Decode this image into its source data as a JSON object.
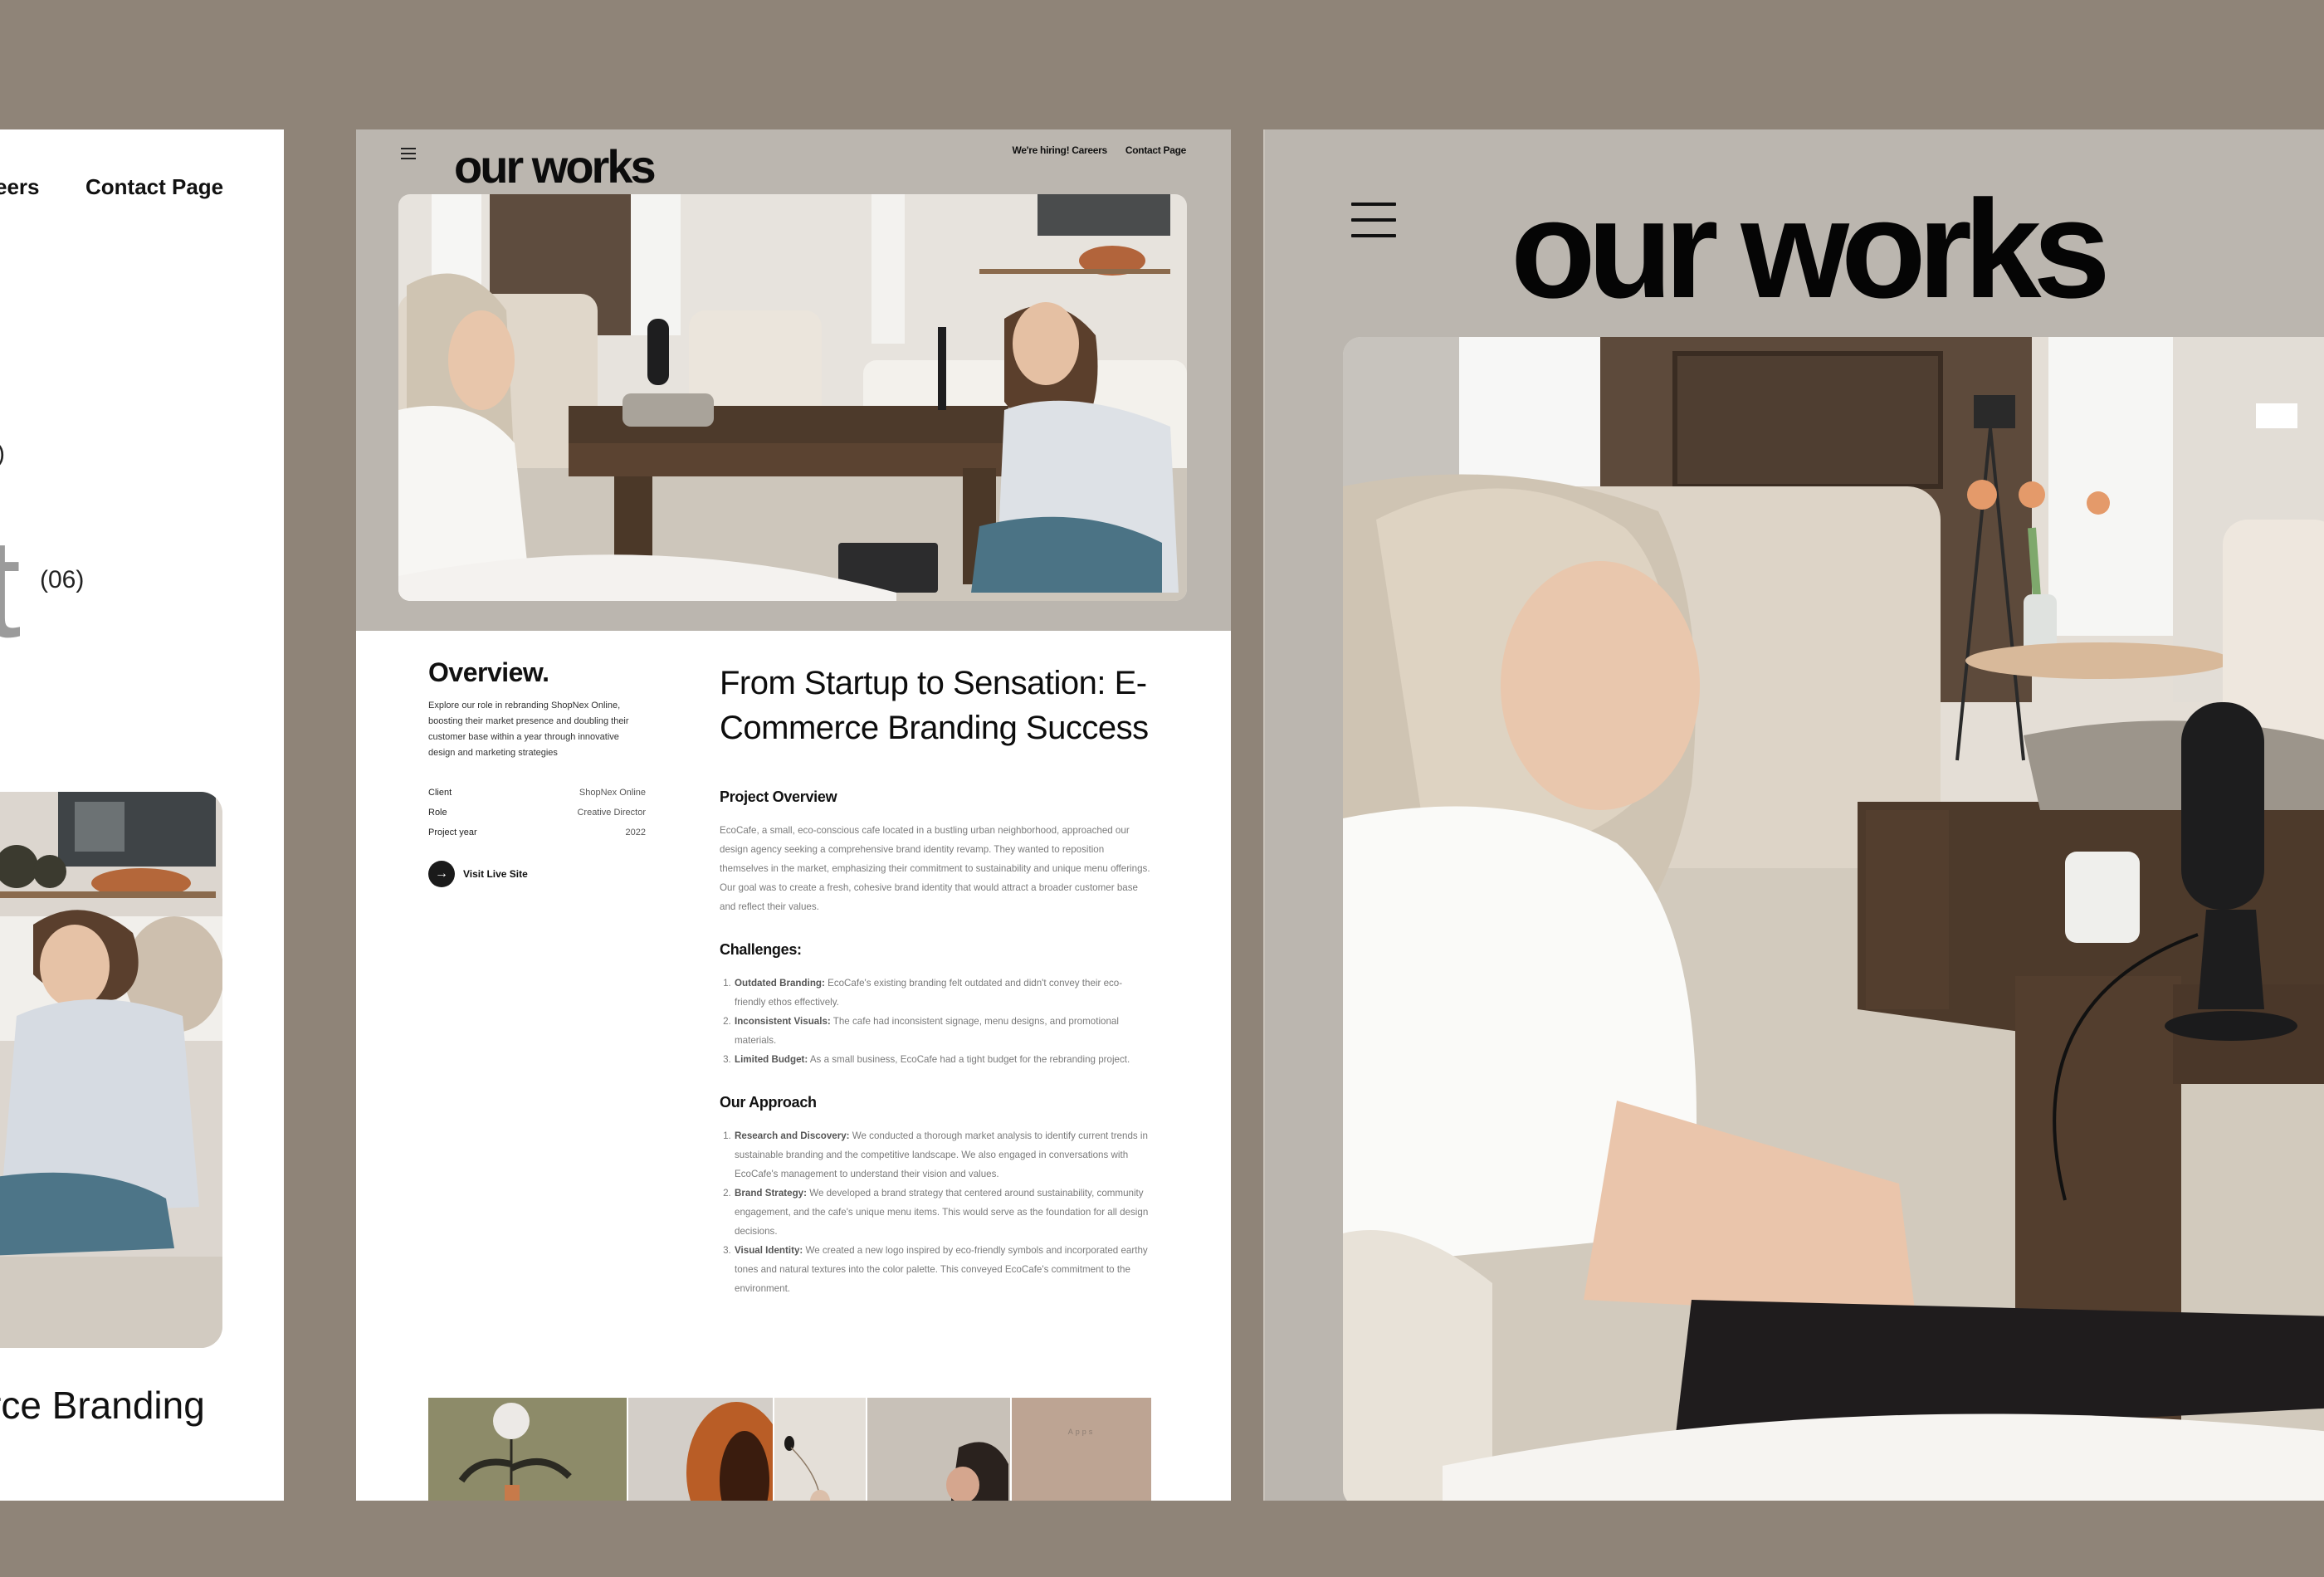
{
  "background_color": "#8f8478",
  "left_panel": {
    "nav": {
      "careers_fragment": "eers",
      "contact": "Contact Page"
    },
    "count_fragment": ")",
    "title_letter_fragment": "t",
    "title_count": "(06)",
    "card_image_alt": "Woman seated on floor smiling beside podcast setup",
    "card_title_fragment": "rce Branding"
  },
  "middle_panel": {
    "header": {
      "logo": "our works",
      "menu_icon": "hamburger-menu-icon",
      "nav": [
        {
          "label": "We're hiring! Careers"
        },
        {
          "label": "Contact Page"
        }
      ]
    },
    "hero_image_alt": "Two women recording a podcast in a living room",
    "overview": {
      "heading": "Overview.",
      "description": "Explore our role in rebranding ShopNex Online, boosting their market presence and doubling their customer base within a year through innovative design and marketing strategies",
      "meta": [
        {
          "label": "Client",
          "value": "ShopNex Online"
        },
        {
          "label": "Role",
          "value": "Creative Director"
        },
        {
          "label": "Project year",
          "value": "2022"
        }
      ],
      "cta": {
        "icon": "arrow-right-icon",
        "label": "Visit Live Site"
      }
    },
    "article": {
      "title": "From Startup to Sensation: E-Commerce Branding Success",
      "project_overview": {
        "heading": "Project Overview",
        "body": "EcoCafe, a small, eco-conscious cafe located in a bustling urban neighborhood, approached our design agency seeking a comprehensive brand identity revamp. They wanted to reposition themselves in the market, emphasizing their commitment to sustainability and unique menu offerings. Our goal was to create a fresh, cohesive brand identity that would attract a broader customer base and reflect their values."
      },
      "challenges": {
        "heading": "Challenges:",
        "items": [
          {
            "title": "Outdated Branding:",
            "text": " EcoCafe's existing branding felt outdated and didn't convey their eco-friendly ethos effectively."
          },
          {
            "title": "Inconsistent Visuals:",
            "text": " The cafe had inconsistent signage, menu designs, and promotional materials."
          },
          {
            "title": "Limited Budget:",
            "text": " As a small business, EcoCafe had a tight budget for the rebranding project."
          }
        ]
      },
      "approach": {
        "heading": "Our Approach",
        "items": [
          {
            "title": "Research and Discovery:",
            "text": " We conducted a thorough market analysis to identify current trends in sustainable branding and the competitive landscape. We also engaged in conversations with EcoCafe's management to understand their vision and values."
          },
          {
            "title": "Brand Strategy:",
            "text": " We developed a brand strategy that centered around sustainability, community engagement, and the cafe's unique menu items. This would serve as the foundation for all design decisions."
          },
          {
            "title": "Visual Identity:",
            "text": " We created a new logo inspired by eco-friendly symbols and incorporated earthy tones and natural textures into the color palette. This conveyed EcoCafe's commitment to the environment."
          }
        ]
      }
    },
    "thumbnails": [
      {
        "alt": "White chrysanthemum in vase",
        "color": "#8c8a68"
      },
      {
        "alt": "Terracotta hat",
        "color": "#c9c3bb"
      },
      {
        "alt": "Dried flower in vase",
        "color": "#e2ddd6"
      },
      {
        "alt": "Woman with dark hair",
        "color": "#c7bfb6"
      },
      {
        "alt": "Apps",
        "label": "Apps",
        "color": "#bda493"
      }
    ]
  },
  "right_panel": {
    "header": {
      "logo": "our works",
      "menu_icon": "hamburger-menu-icon"
    },
    "hero_image_alt": "Woman smiling beside microphone on wooden coffee table"
  }
}
